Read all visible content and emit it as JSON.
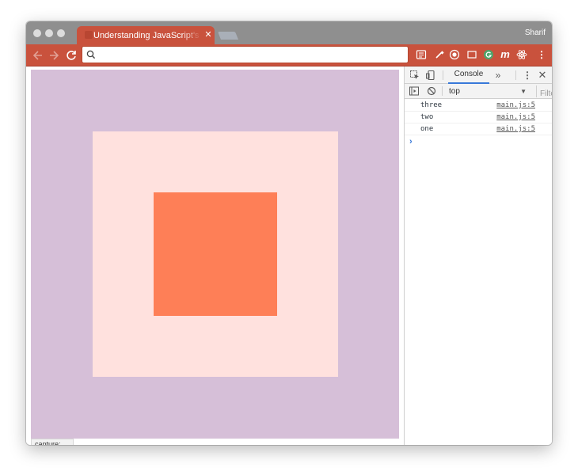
{
  "window": {
    "tab_title": "Understanding JavaScript's Capture",
    "tab_close": "✕",
    "profile_name": "Sharif"
  },
  "toolbar": {
    "omnibox_value": "",
    "extensions": [
      "calendar-extension-icon",
      "eyedropper-icon",
      "record-icon",
      "window-icon",
      "grammarly-icon",
      "m-extension-icon",
      "react-devtools-icon",
      "chrome-menu-icon"
    ]
  },
  "page": {
    "colors": {
      "outer": "#d6bfd8",
      "middle": "#ffe1de",
      "inner": "#fe7f57"
    },
    "status_bubble": "capture: true"
  },
  "devtools": {
    "active_tab": "Console",
    "more_tabs": "»",
    "menu": "⋮",
    "close": "✕",
    "context": "top",
    "context_arrow": "▼",
    "filter_placeholder": "Filter",
    "logs": [
      {
        "message": "three",
        "source": "main.js:5"
      },
      {
        "message": "two",
        "source": "main.js:5"
      },
      {
        "message": "one",
        "source": "main.js:5"
      }
    ],
    "prompt": "›"
  }
}
